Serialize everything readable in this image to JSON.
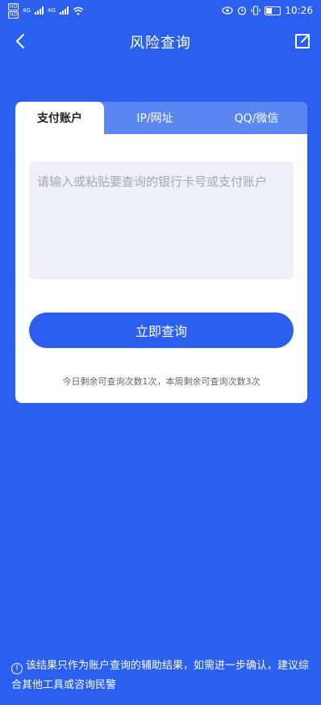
{
  "status_bar": {
    "time": "10:26",
    "hd_label": "HD",
    "net_label": "4G"
  },
  "nav": {
    "title": "风险查询"
  },
  "tabs": [
    {
      "label": "支付账户"
    },
    {
      "label": "IP/网址"
    },
    {
      "label": "QQ/微信"
    }
  ],
  "input": {
    "placeholder": "请输入或粘贴要查询的银行卡号或支付账户",
    "value": ""
  },
  "button": {
    "label": "立即查询"
  },
  "quota": {
    "prefix": "今日剩余可查询次数",
    "today": "1",
    "middle": "次，本周剩余可查询次数",
    "week": "3",
    "suffix": "次"
  },
  "notice": {
    "text": "该结果只作为账户查询的辅助结果，如需进一步确认，建议综合其他工具或咨询民警"
  },
  "colors": {
    "background": "#2b5ff0",
    "tab_inactive": "#5a86f2",
    "input_bg": "#eef0f9"
  }
}
